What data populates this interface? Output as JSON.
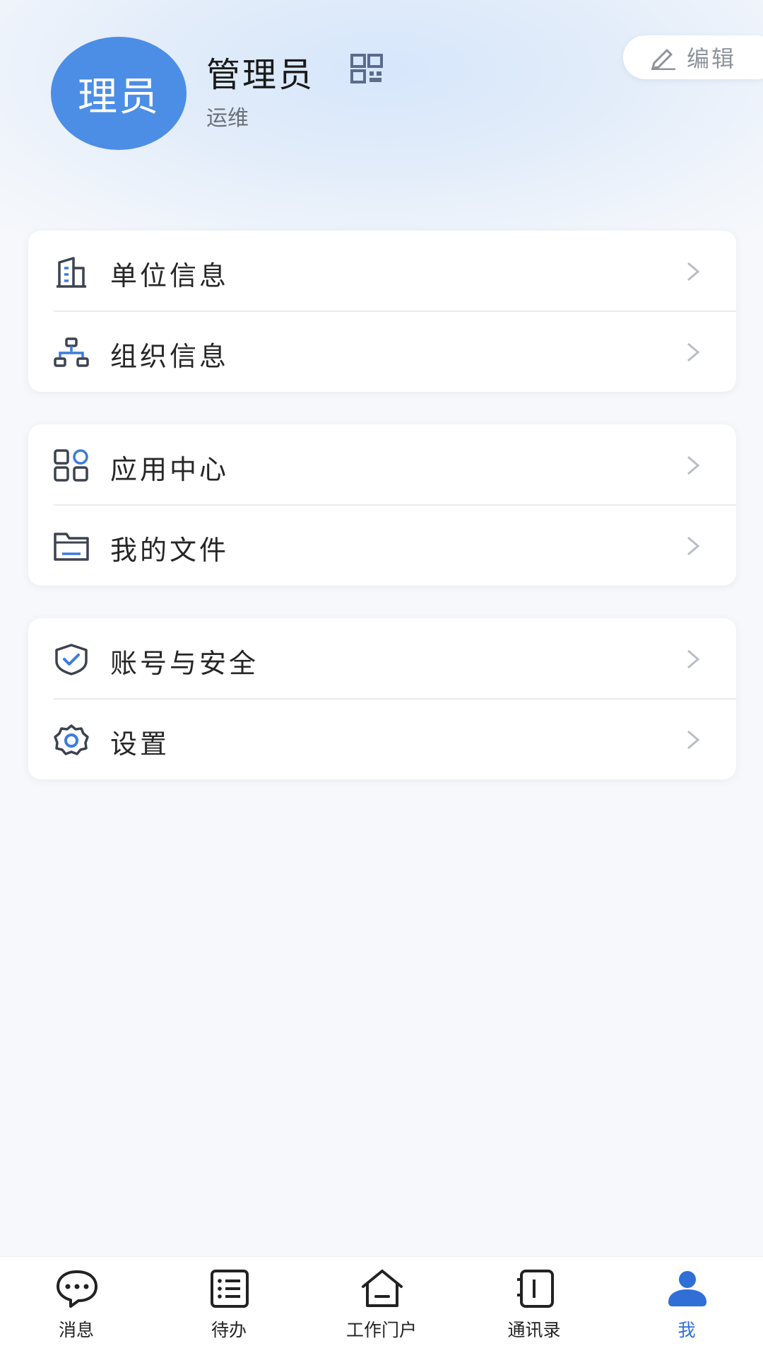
{
  "profile": {
    "avatar_text": "理员",
    "name": "管理员",
    "role": "运维",
    "edit_label": "编辑"
  },
  "menu_groups": [
    {
      "items": [
        {
          "label": "单位信息",
          "icon": "building-icon"
        },
        {
          "label": "组织信息",
          "icon": "org-chart-icon"
        }
      ]
    },
    {
      "items": [
        {
          "label": "应用中心",
          "icon": "apps-grid-icon"
        },
        {
          "label": "我的文件",
          "icon": "folder-icon"
        }
      ]
    },
    {
      "items": [
        {
          "label": "账号与安全",
          "icon": "shield-check-icon"
        },
        {
          "label": "设置",
          "icon": "gear-icon"
        }
      ]
    }
  ],
  "tabbar": {
    "tabs": [
      {
        "label": "消息",
        "icon": "chat-bubble-icon"
      },
      {
        "label": "待办",
        "icon": "list-icon"
      },
      {
        "label": "工作门户",
        "icon": "home-icon"
      },
      {
        "label": "通讯录",
        "icon": "contacts-book-icon"
      },
      {
        "label": "我",
        "icon": "user-icon",
        "active": true
      }
    ]
  },
  "colors": {
    "accent": "#2f6fd6",
    "avatar_bg": "#4c8ee6",
    "icon_dark": "#3d4250",
    "icon_blue": "#3a7be0"
  }
}
